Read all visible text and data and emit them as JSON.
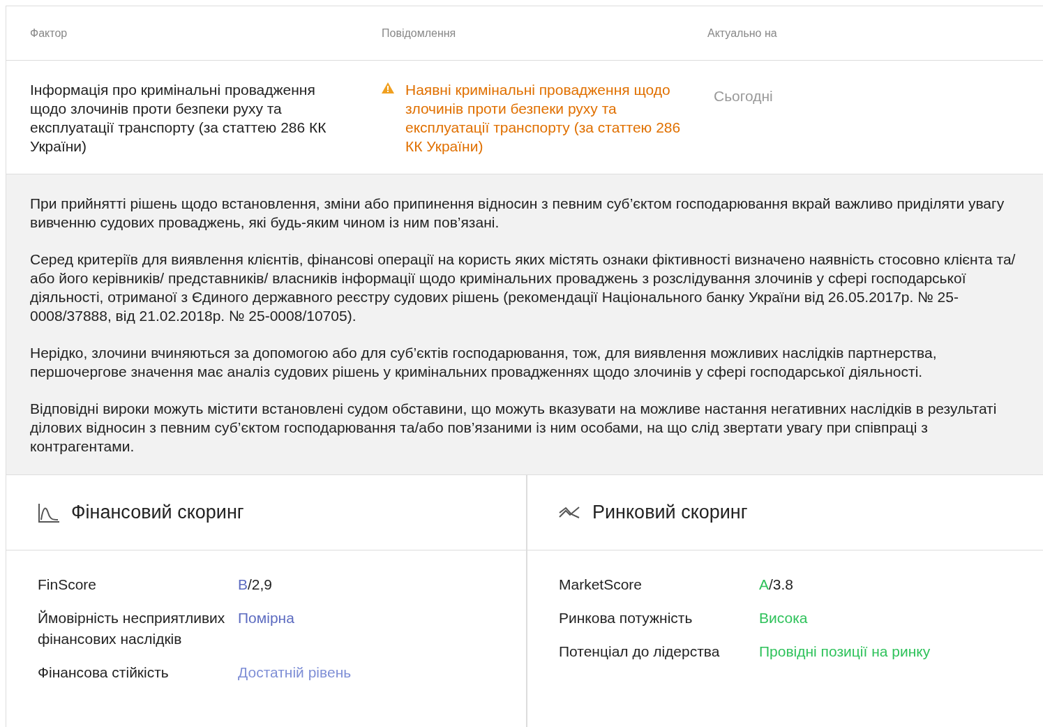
{
  "table": {
    "columns": [
      "Фактор",
      "Повідомлення",
      "Актуально на"
    ],
    "rows": [
      {
        "factor": "Інформація про кримінальні провадження щодо злочинів проти безпеки руху та експлуатації транспорту (за статтею 286 КК України)",
        "message": "Наявні кримінальні провадження щодо злочинів проти безпеки руху та експлуатації транспорту (за статтею 286 КК України)",
        "warning": true,
        "date": "Сьогодні"
      }
    ]
  },
  "details": [
    "При прийнятті рішень щодо встановлення, зміни або припинення відносин з певним суб’єктом господарювання вкрай важливо приділяти увагу вивченню судових проваджень, які будь-яким чином із ним пов’язані.",
    "Серед критеріїв для виявлення клієнтів, фінансові операції на користь яких містять ознаки фіктивності визначено наявність стосовно клієнта та/або його керівників/ представників/ власників інформації щодо кримінальних проваджень з розслідування злочинів у сфері господарської діяльності, отриманої з Єдиного державного реєстру судових рішень (рекомендації Національного банку України від 26.05.2017р. № 25-0008/37888, від 21.02.2018р. № 25-0008/10705).",
    "Нерідко, злочини вчиняються за допомогою або для суб’єктів господарювання, тож, для виявлення можливих наслідків партнерства, першочергове значення має аналіз судових рішень у кримінальних провадженнях щодо злочинів у сфері господарської діяльності.",
    "Відповідні вироки можуть містити встановлені судом обставини, що можуть вказувати на можливе настання негативних наслідків в результаті ділових відносин з певним суб’єктом господарювання та/або пов’язаними із ним особами, на що слід звертати увагу при співпраці з контрагентами."
  ],
  "scorings": [
    {
      "title": "Фінансовий скоринг",
      "kind": "finance",
      "items": [
        {
          "label": "FinScore",
          "grade": "B",
          "value": "/2,9",
          "color": "#5c6bc0"
        },
        {
          "label": "Ймовірність несприятливих фінансових наслідків",
          "value": "Помірна",
          "color": "#5c6bc0"
        },
        {
          "label": "Фінансова стійкість",
          "value": "Достатній рівень",
          "color": "#7f8fd6"
        }
      ]
    },
    {
      "title": "Ринковий скоринг",
      "kind": "market",
      "items": [
        {
          "label": "MarketScore",
          "grade": "A",
          "value": "/3.8",
          "color": "#2fc25b"
        },
        {
          "label": "Ринкова потужність",
          "value": "Висока",
          "color": "#2fc25b"
        },
        {
          "label": "Потенціал до лідерства",
          "value": "Провідні позиції на ринку",
          "color": "#2fc25b"
        }
      ]
    }
  ]
}
